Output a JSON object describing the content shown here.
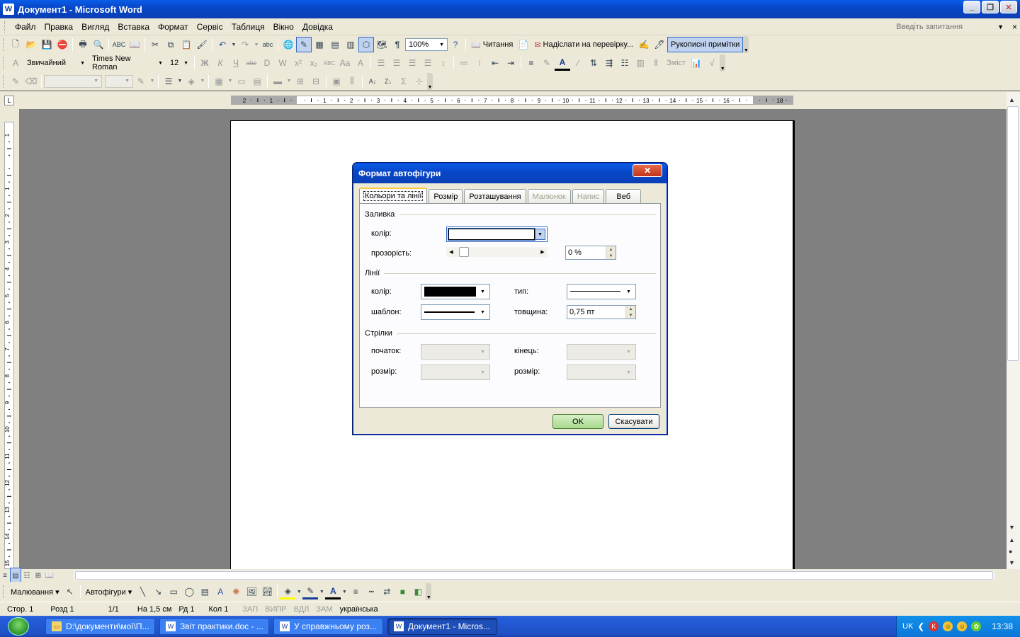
{
  "window": {
    "title": "Документ1 - Microsoft Word",
    "minimize": "_",
    "restore": "❐",
    "close": "✕"
  },
  "menu": {
    "items": [
      "Файл",
      "Правка",
      "Вигляд",
      "Вставка",
      "Формат",
      "Сервіс",
      "Таблиця",
      "Вікно",
      "Довідка"
    ],
    "ask_placeholder": "Введіть запитання"
  },
  "toolbar_standard": {
    "zoom": "100%",
    "reading_label": "Читання",
    "send_review_label": "Надіслати на перевірку...",
    "ink_label": "Рукописні примітки"
  },
  "toolbar_formatting": {
    "style": "Звичайний",
    "font": "Times New Roman",
    "size": "12",
    "contents_label": "Зміст"
  },
  "dialog": {
    "title": "Формат автофігури",
    "tabs": [
      {
        "label": "Кольори та лінії",
        "selected": true,
        "disabled": false
      },
      {
        "label": "Розмір",
        "selected": false,
        "disabled": false
      },
      {
        "label": "Розташування",
        "selected": false,
        "disabled": false
      },
      {
        "label": "Малюнок",
        "selected": false,
        "disabled": true
      },
      {
        "label": "Напис",
        "selected": false,
        "disabled": true
      },
      {
        "label": "Веб",
        "selected": false,
        "disabled": false
      }
    ],
    "fill": {
      "group": "Заливка",
      "color_label": "колір:",
      "transparency_label": "прозорість:",
      "transparency_value": "0 %",
      "transparency_fraction": 0
    },
    "lines": {
      "group": "Лінії",
      "color_label": "колір:",
      "type_label": "тип:",
      "pattern_label": "шаблон:",
      "weight_label": "товщина:",
      "weight_value": "0,75 пт",
      "line_color": "#000000"
    },
    "arrows": {
      "group": "Стрілки",
      "begin_label": "початок:",
      "end_label": "кінець:",
      "begin_size_label": "розмір:",
      "end_size_label": "розмір:"
    },
    "ok": "OK",
    "cancel": "Скасувати"
  },
  "drawing_toolbar": {
    "draw_label": "Малювання ▾",
    "autoshapes_label": "Автофігури ▾"
  },
  "status": {
    "page": "Стор.  1",
    "section": "Розд  1",
    "pages": "1/1",
    "at": "На  1,5 см",
    "line": "Рд  1",
    "col": "Кол  1",
    "rec": "ЗАП",
    "trk": "ВИПР",
    "ext": "ВДЛ",
    "ovr": "ЗАМ",
    "lang": "українська"
  },
  "taskbar": {
    "tasks": [
      {
        "label": "D:\\документи\\мої\\П...",
        "icon": "folder",
        "active": false
      },
      {
        "label": "Звіт практики.doc - ...",
        "icon": "word",
        "active": false
      },
      {
        "label": "У справжньому роз...",
        "icon": "word",
        "active": false
      },
      {
        "label": "Документ1 - Micros...",
        "icon": "word",
        "active": true
      }
    ],
    "lang": "UK",
    "time": "13:38"
  },
  "ruler": {
    "h_labels": [
      "2",
      "1",
      "",
      "1",
      "2",
      "3",
      "4",
      "5",
      "6",
      "7",
      "8",
      "9",
      "10",
      "11",
      "12",
      "13",
      "14",
      "15",
      "16",
      "",
      "18"
    ],
    "v_labels": [
      "1",
      "",
      "1",
      "2",
      "3",
      "4",
      "5",
      "6",
      "7",
      "8",
      "9",
      "10",
      "11",
      "12",
      "13",
      "14",
      "15"
    ]
  }
}
